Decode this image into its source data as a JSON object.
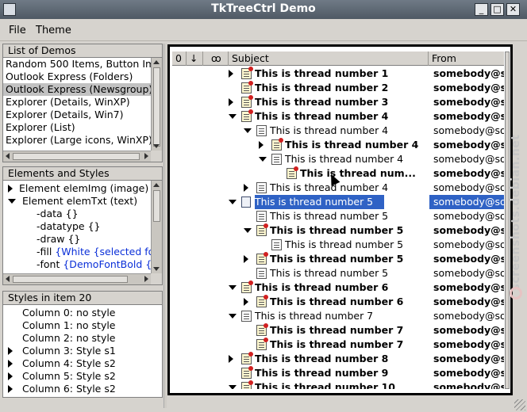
{
  "window": {
    "title": "TkTreeCtrl Demo",
    "buttons": {
      "minimize": "_",
      "maximize": "□",
      "close": "✕"
    }
  },
  "menu": {
    "items": [
      "File",
      "Theme"
    ]
  },
  "demos_panel": {
    "header": "List of Demos",
    "items": [
      "Random 500 Items, Button Im",
      "Outlook Express (Folders)",
      "Outlook Express (Newsgroup)",
      "Explorer (Details, WinXP)",
      "Explorer (Details, Win7)",
      "Explorer (List)",
      "Explorer (Large icons, WinXP)"
    ],
    "selected_index": 2
  },
  "elements_panel": {
    "header": "Elements and Styles",
    "rows": [
      {
        "text": "Element elemImg (image)",
        "expander": "collapsed",
        "indent": 0
      },
      {
        "text": "Element elemTxt (text)",
        "expander": "expanded",
        "indent": 0
      },
      {
        "text": "-data {}",
        "indent": 1
      },
      {
        "text": "-datatype {}",
        "indent": 1
      },
      {
        "text": "-draw {}",
        "indent": 1
      },
      {
        "text": "-fill ",
        "blue": "{White {selected foc",
        "indent": 1
      },
      {
        "text": "-font ",
        "blue": "{DemoFontBold {r",
        "indent": 1
      }
    ]
  },
  "styles_panel": {
    "header": "Styles in item 20",
    "rows": [
      {
        "text": "Column 0: no style",
        "expander": "none"
      },
      {
        "text": "Column 1: no style",
        "expander": "none"
      },
      {
        "text": "Column 2: no style",
        "expander": "none"
      },
      {
        "text": "Column 3: Style s1",
        "expander": "collapsed"
      },
      {
        "text": "Column 4: Style s2",
        "expander": "collapsed"
      },
      {
        "text": "Column 5: Style s2",
        "expander": "collapsed"
      },
      {
        "text": "Column 6: Style s2",
        "expander": "collapsed"
      }
    ]
  },
  "tree": {
    "columns": {
      "attach": "0",
      "flag": "↓",
      "watch": "ꝏ",
      "subject": "Subject",
      "from": "From"
    },
    "rows": [
      {
        "level": 0,
        "expander": "collapsed",
        "unread": true,
        "bold": true,
        "subject": "This is thread number 1",
        "from": "somebody@somewhere.net"
      },
      {
        "level": 0,
        "expander": "none",
        "unread": true,
        "bold": true,
        "subject": "This is thread number 2",
        "from": "somebody@somewhere.net"
      },
      {
        "level": 0,
        "expander": "collapsed",
        "unread": true,
        "bold": true,
        "subject": "This is thread number 3",
        "from": "somebody@somewhere.net"
      },
      {
        "level": 0,
        "expander": "expanded",
        "unread": true,
        "bold": true,
        "subject": "This is thread number 4",
        "from": "somebody@somewhere.net"
      },
      {
        "level": 1,
        "expander": "expanded",
        "unread": false,
        "bold": false,
        "subject": "This is thread number 4",
        "from": "somebody@somewhere.net"
      },
      {
        "level": 2,
        "expander": "collapsed",
        "unread": true,
        "bold": true,
        "subject": "This is thread number 4",
        "from": "somebody@somewhere.net"
      },
      {
        "level": 2,
        "expander": "expanded",
        "unread": false,
        "bold": false,
        "subject": "This is thread number 4",
        "from": "somebody@somewhere.net"
      },
      {
        "level": 3,
        "expander": "none",
        "unread": true,
        "bold": true,
        "subject": "This is thread num...",
        "from": "somebody@somewhere.net"
      },
      {
        "level": 1,
        "expander": "collapsed",
        "unread": false,
        "bold": false,
        "subject": "This is thread number 4",
        "from": "somebody@somewhere.net"
      },
      {
        "level": 0,
        "expander": "expanded",
        "unread": false,
        "bold": false,
        "selected": true,
        "subject": "This is thread number 5",
        "from": "somebody@somewhere.net"
      },
      {
        "level": 1,
        "expander": "none",
        "unread": false,
        "bold": false,
        "subject": "This is thread number 5",
        "from": "somebody@somewhere.net"
      },
      {
        "level": 1,
        "expander": "expanded",
        "unread": true,
        "bold": true,
        "subject": "This is thread number 5",
        "from": "somebody@somewhere.net"
      },
      {
        "level": 2,
        "expander": "none",
        "unread": false,
        "bold": false,
        "subject": "This is thread number 5",
        "from": "somebody@somewhere.net"
      },
      {
        "level": 1,
        "expander": "collapsed",
        "unread": true,
        "bold": true,
        "subject": "This is thread number 5",
        "from": "somebody@somewhere.net"
      },
      {
        "level": 1,
        "expander": "none",
        "unread": false,
        "bold": false,
        "subject": "This is thread number 5",
        "from": "somebody@somewhere.net"
      },
      {
        "level": 0,
        "expander": "expanded",
        "unread": true,
        "bold": true,
        "subject": "This is thread number 6",
        "from": "somebody@somewhere.net"
      },
      {
        "level": 1,
        "expander": "collapsed",
        "unread": true,
        "bold": true,
        "subject": "This is thread number 6",
        "from": "somebody@somewhere.net"
      },
      {
        "level": 0,
        "expander": "expanded",
        "unread": false,
        "bold": false,
        "subject": "This is thread number 7",
        "from": "somebody@somewhere.net"
      },
      {
        "level": 1,
        "expander": "none",
        "unread": true,
        "bold": true,
        "subject": "This is thread number 7",
        "from": "somebody@somewhere.net"
      },
      {
        "level": 1,
        "expander": "none",
        "unread": true,
        "bold": true,
        "subject": "This is thread number 7",
        "from": "somebody@somewhere.net"
      },
      {
        "level": 0,
        "expander": "collapsed",
        "unread": true,
        "bold": true,
        "subject": "This is thread number 8",
        "from": "somebody@somewhere.net"
      },
      {
        "level": 0,
        "expander": "none",
        "unread": true,
        "bold": true,
        "subject": "This is thread number 9",
        "from": "somebody@somewhere.net"
      },
      {
        "level": 0,
        "expander": "expanded",
        "unread": true,
        "bold": true,
        "subject": "This is thread number 10",
        "from": "somebody@somewhere.net"
      }
    ]
  },
  "watermark": "screenshots.debian.net",
  "colors": {
    "selection": "#2f62c5",
    "titlebar": "#5b6570",
    "link_blue": "#0a2fd8"
  }
}
